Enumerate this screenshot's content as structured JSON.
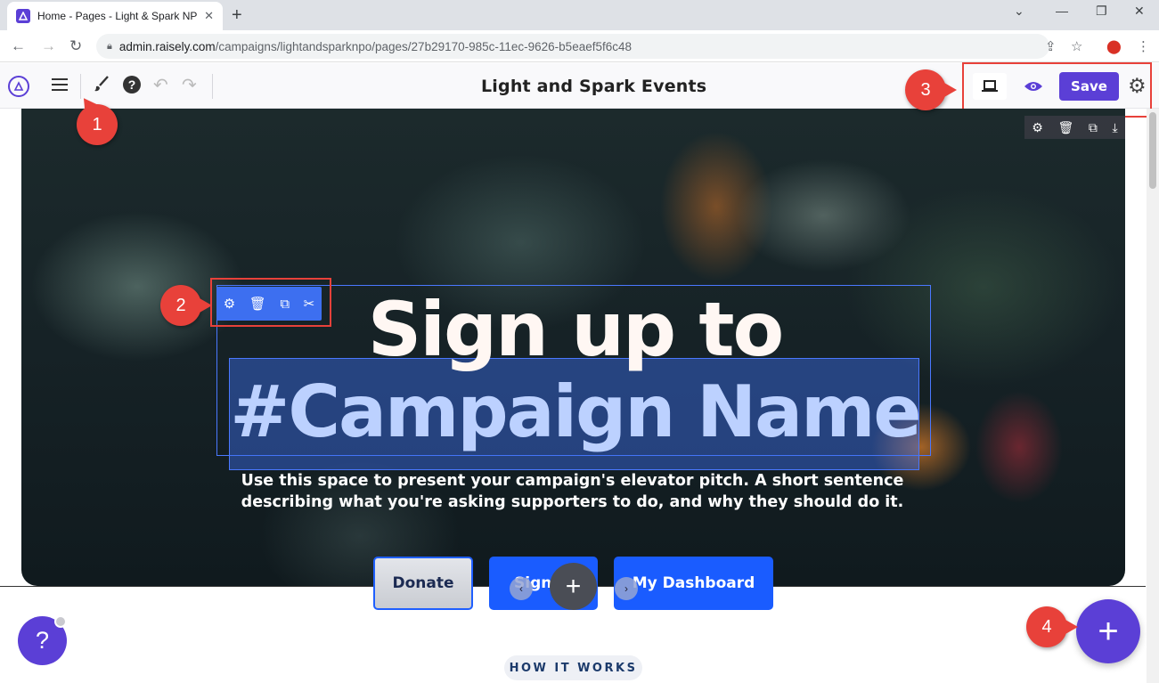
{
  "browser": {
    "tab_title": "Home - Pages - Light & Spark NPO",
    "url_host": "admin.raisely.com",
    "url_path": "/campaigns/lightandsparknpo/pages/27b29170-985c-11ec-9626-b5eaef5f6c48"
  },
  "toolbar": {
    "page_title": "Light and Spark Events",
    "save_label": "Save"
  },
  "hero": {
    "headline_line1": "Sign up to",
    "headline_line2": "#Campaign Name",
    "pitch": "Use this space to present your campaign's elevator pitch. A short sentence describing what you're asking supporters to do, and why they should do it.",
    "buttons": {
      "donate": "Donate",
      "signup": "Sign",
      "dashboard": "My Dashboard"
    }
  },
  "section": {
    "how_it_works": "HOW IT WORKS"
  },
  "help": {
    "label": "?"
  },
  "callouts": [
    "1",
    "2",
    "3",
    "4"
  ],
  "colors": {
    "brand": "#5b3fd6",
    "button_blue": "#1a5cff",
    "annotation_red": "#e8413a",
    "selection_blue": "#3d6ff0"
  },
  "icons": [
    "hamburger-icon",
    "brush-icon",
    "help-icon",
    "undo-icon",
    "redo-icon",
    "laptop-icon",
    "eye-icon",
    "gear-icon",
    "trash-icon",
    "duplicate-icon",
    "download-icon",
    "scissors-icon",
    "plus-icon"
  ]
}
